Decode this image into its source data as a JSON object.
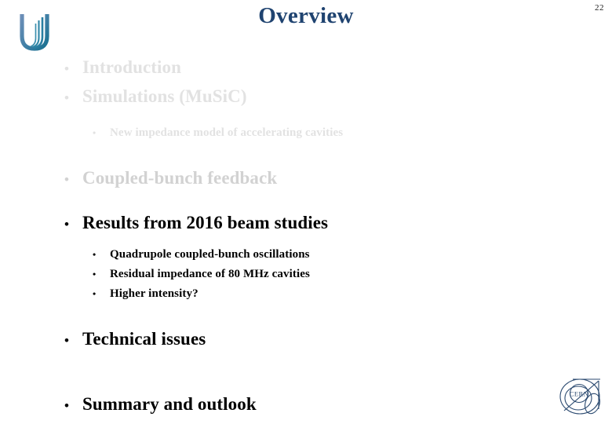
{
  "slide": {
    "title": "Overview",
    "page_number": "22",
    "title_color": "#1f4370",
    "background_color": "#ffffff",
    "active_text_color": "#000000",
    "dimmed_text_color": "#d2d2d2",
    "faint_text_color": "#e2e2e2"
  },
  "logos": {
    "university": {
      "name": "university-u-logo",
      "color_start": "#5a7fae",
      "color_end": "#1b6f8f"
    },
    "cern": {
      "name": "cern-logo",
      "label": "CERN",
      "color": "#1f4370"
    }
  },
  "outline": {
    "bullet_marker_level1": "•",
    "bullet_marker_level2": "•",
    "items": [
      {
        "level": 1,
        "text": "Introduction",
        "state": "faint"
      },
      {
        "level": 1,
        "text": "Simulations (MuSiC)",
        "state": "faint"
      },
      {
        "level": 2,
        "text": "New impedance model of accelerating cavities",
        "state": "faint"
      },
      {
        "level": 1,
        "text": "Coupled-bunch feedback",
        "state": "dim"
      },
      {
        "level": 1,
        "text": "Results from 2016 beam studies",
        "state": "active"
      },
      {
        "level": 2,
        "text": "Quadrupole coupled-bunch oscillations",
        "state": "active"
      },
      {
        "level": 2,
        "text": "Residual impedance of 80 MHz cavities",
        "state": "active"
      },
      {
        "level": 2,
        "text": "Higher intensity?",
        "state": "active"
      },
      {
        "level": 1,
        "text": "Technical issues",
        "state": "active"
      },
      {
        "level": 1,
        "text": "Summary and outlook",
        "state": "active"
      }
    ]
  }
}
